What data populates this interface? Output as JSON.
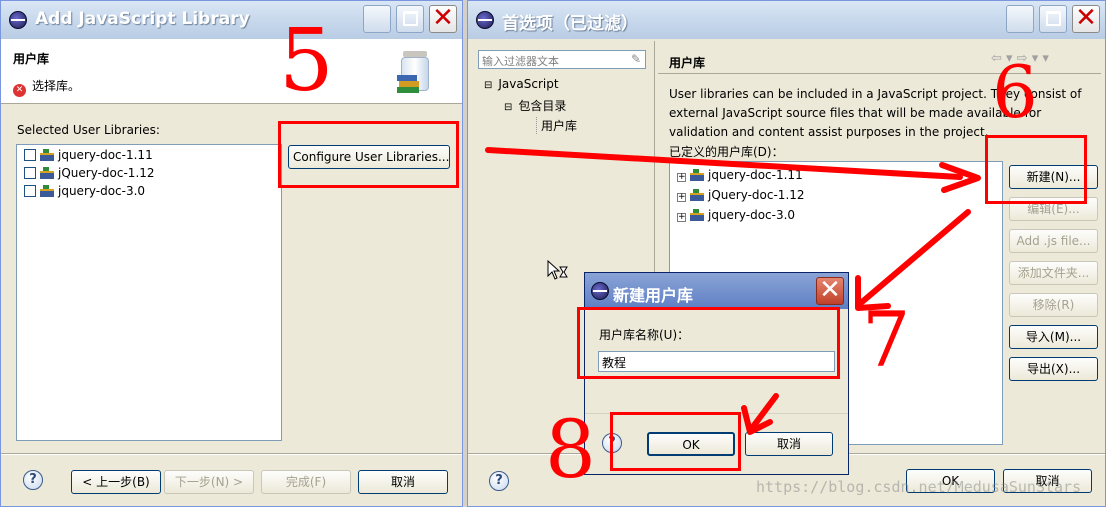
{
  "left_window": {
    "title": "Add JavaScript Library",
    "section_title": "用户库",
    "error_text": "选择库。",
    "list_label": "Selected User Libraries:",
    "libraries": [
      "jquery-doc-1.11",
      "jQuery-doc-1.12",
      "jquery-doc-3.0"
    ],
    "configure_button": "Configure User Libraries...",
    "back_button": "< 上一步(B)",
    "next_button": "下一步(N) >",
    "finish_button": "完成(F)",
    "cancel_button": "取消"
  },
  "right_window": {
    "title": "首选项（已过滤）",
    "filter_placeholder": "输入过滤器文本",
    "tree": [
      "JavaScript",
      "包含目录",
      "用户库"
    ],
    "page_title": "用户库",
    "description": "User libraries can be included in a JavaScript project. They consist of external JavaScript source files that will be made available for validation and content assist purposes in the project.",
    "defined_label": "已定义的用户库(D)：",
    "libraries": [
      "jquery-doc-1.11",
      "jQuery-doc-1.12",
      "jquery-doc-3.0"
    ],
    "buttons": {
      "new": "新建(N)...",
      "edit": "编辑(E)...",
      "add_js": "Add .js file...",
      "add_folder": "添加文件夹...",
      "remove": "移除(R)",
      "import": "导入(M)...",
      "export": "导出(X)..."
    },
    "ok_button": "OK",
    "cancel_button": "取消"
  },
  "dialog": {
    "title": "新建用户库",
    "name_label": "用户库名称(U)：",
    "name_value": "教程",
    "ok_button": "OK",
    "cancel_button": "取消"
  },
  "annotations": {
    "step5": "5",
    "step6": "6",
    "step7": "7",
    "step8": "8",
    "annotation_color": "#ff0000"
  },
  "watermark": "https://blog.csdn.net/MedusaSunStars"
}
